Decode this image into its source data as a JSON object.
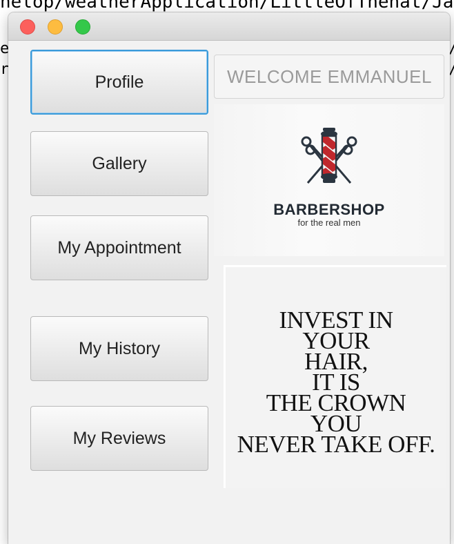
{
  "background": {
    "path_line": "nelop/weatherApplication/LittleOfThehat/Ja",
    "side_left_1": "e",
    "side_left_2": "r",
    "side_right_1": "/",
    "side_right_2": "/"
  },
  "window": {
    "controls": [
      "close",
      "minimize",
      "maximize"
    ]
  },
  "sidebar": {
    "items": [
      {
        "label": "Profile"
      },
      {
        "label": "Gallery"
      },
      {
        "label": "My Appointment"
      },
      {
        "label": "My History"
      },
      {
        "label": "My Reviews"
      }
    ]
  },
  "header": {
    "welcome": "WELCOME EMMANUEL"
  },
  "logo": {
    "name": "BARBERSHOP",
    "tagline": "for the real men",
    "icon": "barber-pole-with-scissors-icon"
  },
  "quote": {
    "lines": [
      "INVEST IN",
      "YOUR",
      "HAIR,",
      "IT IS",
      "THE CROWN",
      "YOU",
      "NEVER TAKE OFF."
    ]
  },
  "colors": {
    "focus_ring": "#3a9ad9",
    "pole_red": "#c0282d",
    "pole_dark": "#2b3540"
  }
}
